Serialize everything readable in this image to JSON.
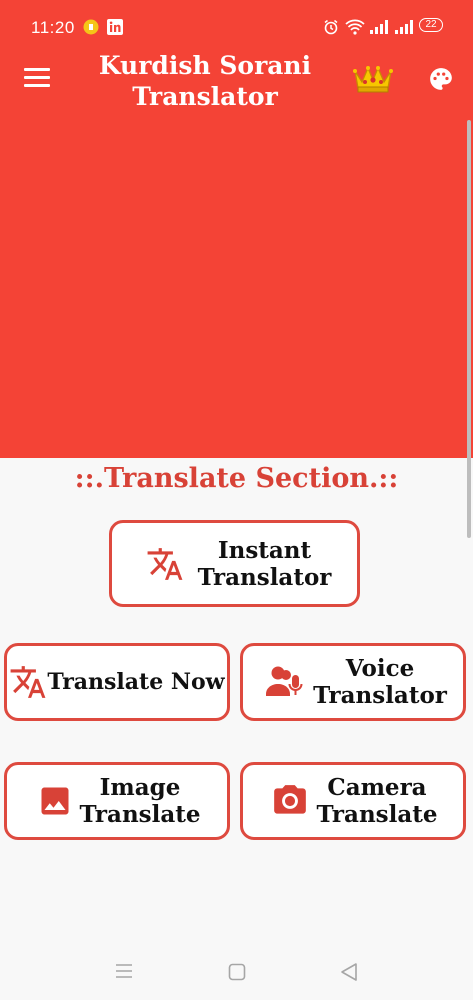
{
  "status_bar": {
    "time": "11:20",
    "battery": "22"
  },
  "app_bar": {
    "title": "Kurdish Sorani Translator"
  },
  "section": {
    "title": "::.Translate Section.::"
  },
  "buttons": {
    "instant": "Instant Translator",
    "translate_now": "Translate Now",
    "voice": "Voice Translator",
    "image": "Image Translate",
    "camera": "Camera Translate"
  },
  "icons": {
    "menu": "hamburger-menu-icon",
    "crown": "crown-icon",
    "palette": "palette-icon",
    "translate": "translate-icon",
    "voice": "record-voice-icon",
    "image": "image-icon",
    "camera": "camera-icon"
  },
  "colors": {
    "primary": "#f44336",
    "accent": "#de4a3f",
    "section_title": "#d84237",
    "background": "#f8f8f8"
  }
}
